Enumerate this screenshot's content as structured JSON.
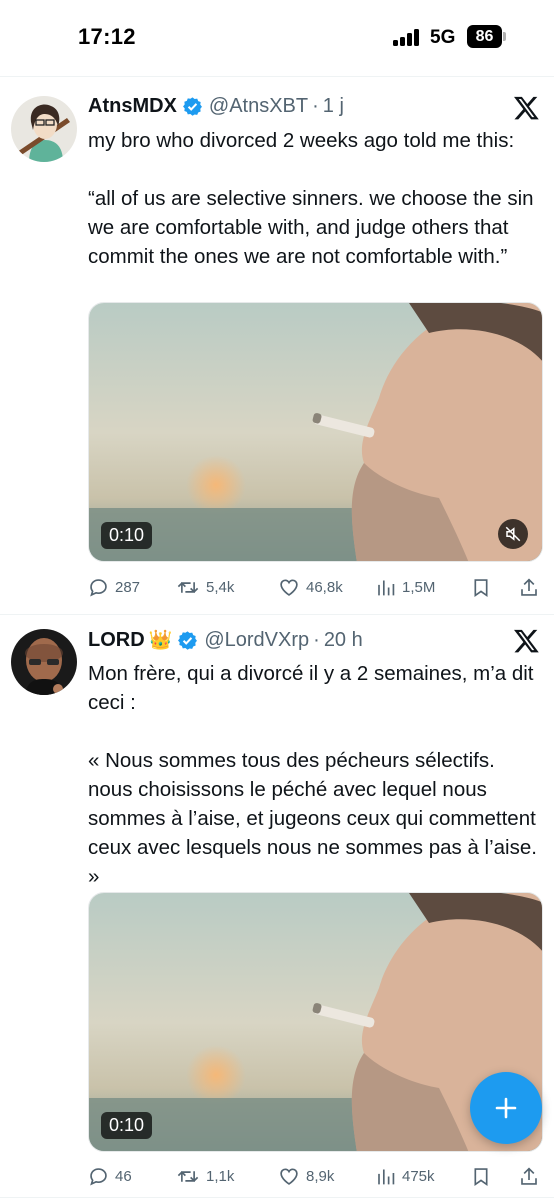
{
  "status_bar": {
    "time": "17:12",
    "network": "5G",
    "battery": "86"
  },
  "tweets": [
    {
      "name": "AtnsMDX",
      "badge": "",
      "handle": "@AtnsXBT",
      "time": "1 j",
      "text": "my bro who divorced 2 weeks ago told me this:\n\n“all of us are selective sinners. we choose the sin we are comfortable with, and judge others that commit the ones we are not comfortable with.”",
      "video_duration": "0:10",
      "stats": {
        "replies": "287",
        "reposts": "5,4k",
        "likes": "46,8k",
        "views": "1,5M"
      }
    },
    {
      "name": "LORD",
      "badge": "👑",
      "handle": "@LordVXrp",
      "time": "20 h",
      "text": "Mon frère, qui a divorcé il y a 2 semaines, m’a dit ceci :\n\n« Nous sommes tous des pécheurs sélectifs. nous choisissons le péché avec lequel nous sommes à l’aise, et jugeons ceux qui commettent ceux avec lesquels nous ne sommes pas à l’aise. »",
      "video_duration": "0:10",
      "stats": {
        "replies": "46",
        "reposts": "1,1k",
        "likes": "8,9k",
        "views": "475k"
      }
    }
  ],
  "colors": {
    "accent": "#1d9bf0",
    "text": "#0f1419",
    "secondary": "#536471",
    "divider": "#eff3f4"
  },
  "icons": {
    "verified": "verified-badge-icon",
    "platform": "x-logo-icon",
    "reply": "reply-icon",
    "repost": "repost-icon",
    "like": "heart-icon",
    "views": "views-icon",
    "bookmark": "bookmark-icon",
    "share": "share-icon",
    "mute": "mute-icon",
    "compose": "plus-icon"
  }
}
